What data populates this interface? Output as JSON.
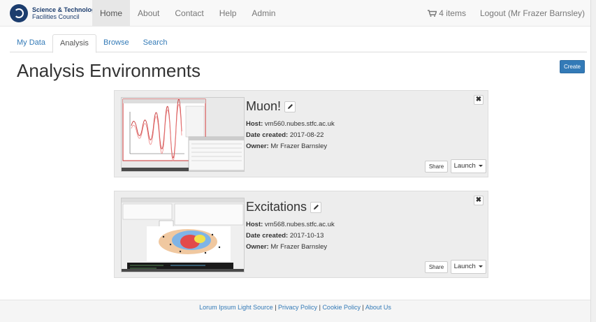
{
  "brand": {
    "line1": "Science & Technology",
    "line2": "Facilities Council"
  },
  "nav": {
    "items": [
      {
        "label": "Home",
        "active": true
      },
      {
        "label": "About",
        "active": false
      },
      {
        "label": "Contact",
        "active": false
      },
      {
        "label": "Help",
        "active": false
      },
      {
        "label": "Admin",
        "active": false
      }
    ],
    "cart_label": "4 items",
    "logout_label": "Logout (Mr Frazer Barnsley)"
  },
  "tabs": [
    {
      "label": "My Data",
      "active": false
    },
    {
      "label": "Analysis",
      "active": true
    },
    {
      "label": "Browse",
      "active": false
    },
    {
      "label": "Search",
      "active": false
    }
  ],
  "page": {
    "title": "Analysis Environments",
    "create_label": "Create"
  },
  "cards": [
    {
      "title": "Muon!",
      "host_label": "Host:",
      "host": "vm560.nubes.stfc.ac.uk",
      "date_label": "Date created:",
      "date": "2017-08-22",
      "owner_label": "Owner:",
      "owner": "Mr Frazer Barnsley",
      "share_label": "Share",
      "launch_label": "Launch"
    },
    {
      "title": "Excitations",
      "host_label": "Host:",
      "host": "vm568.nubes.stfc.ac.uk",
      "date_label": "Date created:",
      "date": "2017-10-13",
      "owner_label": "Owner:",
      "owner": "Mr Frazer Barnsley",
      "share_label": "Share",
      "launch_label": "Launch"
    }
  ],
  "footer": {
    "links": [
      "Lorum Ipsum Light Source",
      "Privacy Policy",
      "Cookie Policy",
      "About Us"
    ],
    "separator": "|"
  },
  "colors": {
    "brand": "#1c3d6e",
    "link": "#337ab7",
    "primary_button": "#337ab7"
  },
  "icons": {
    "cart": "shopping-cart-icon",
    "edit": "pencil-icon",
    "close": "close-icon",
    "caret": "caret-down-icon"
  }
}
